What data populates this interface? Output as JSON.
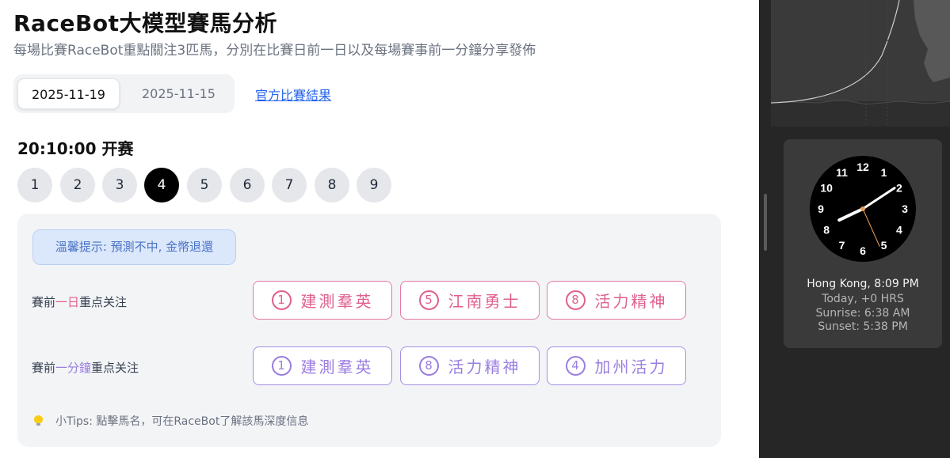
{
  "header": {
    "title": "RaceBot大模型賽馬分析",
    "subtitle": "每場比賽RaceBot重點關注3匹馬，分別在比賽日前一日以及每場賽事前一分鐘分享發佈"
  },
  "dates": {
    "active": "2025-11-19",
    "inactive": "2025-11-15",
    "official_link": "官方比賽結果"
  },
  "start_time": "20:10:00 开赛",
  "races": {
    "items": [
      "1",
      "2",
      "3",
      "4",
      "5",
      "6",
      "7",
      "8",
      "9"
    ],
    "selected": "4"
  },
  "panel": {
    "notice": "溫馨提示: 預測不中, 金幣退還",
    "day_before": {
      "label_prefix": "賽前",
      "label_highlight": "一日",
      "label_suffix": "重点关注",
      "picks": [
        {
          "num": "1",
          "name": "建測羣英"
        },
        {
          "num": "5",
          "name": "江南勇士"
        },
        {
          "num": "8",
          "name": "活力精神"
        }
      ]
    },
    "minute_before": {
      "label_prefix": "賽前",
      "label_highlight": "一分鐘",
      "label_suffix": "重点关注",
      "picks": [
        {
          "num": "1",
          "name": "建測羣英"
        },
        {
          "num": "8",
          "name": "活力精神"
        },
        {
          "num": "4",
          "name": "加州活力"
        }
      ]
    },
    "tips": "小Tips: 點擊馬名，可在RaceBot了解該馬深度信息"
  },
  "clock_widget": {
    "numerals": [
      "12",
      "1",
      "2",
      "3",
      "4",
      "5",
      "6",
      "7",
      "8",
      "9",
      "10",
      "11"
    ],
    "city_time": "Hong Kong, 8:09 PM",
    "offset": "Today, +0 HRS",
    "sunrise": "Sunrise: 6:38 AM",
    "sunset": "Sunset: 5:38 PM",
    "time": {
      "hour": 20,
      "minute": 9,
      "second": 26
    }
  },
  "colors": {
    "pink": "#e0608f",
    "purple": "#9a7ee0",
    "link": "#2563eb",
    "selected_race": "#000000"
  }
}
